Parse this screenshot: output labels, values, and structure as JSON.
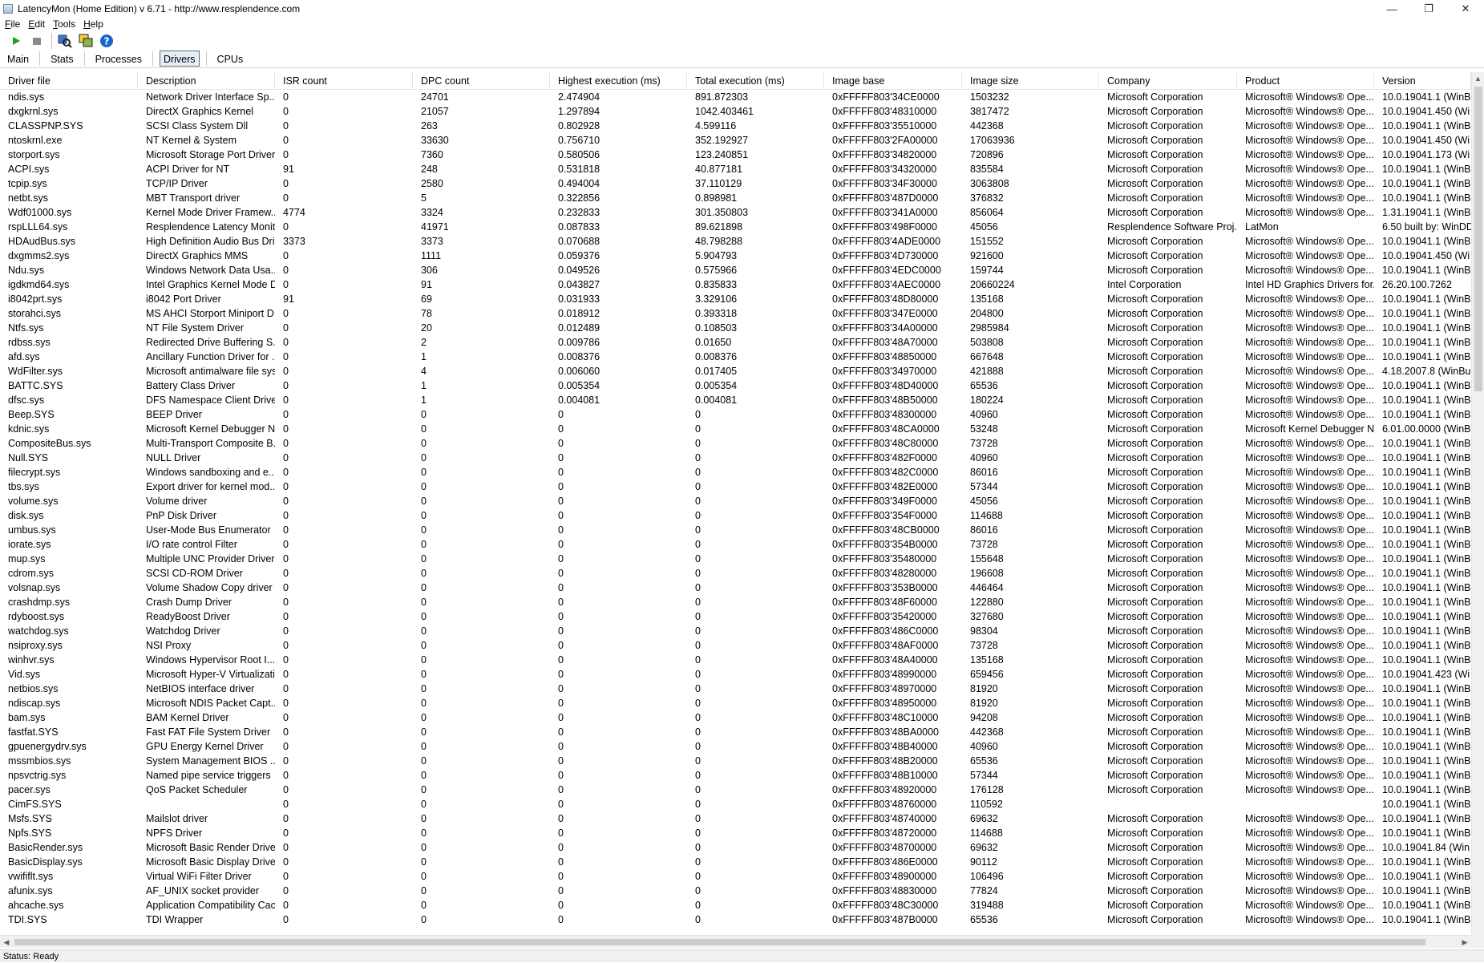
{
  "window": {
    "title": "LatencyMon  (Home Edition)  v 6.71 - http://www.resplendence.com",
    "controls": [
      "—",
      "❐",
      "✕"
    ]
  },
  "menu": [
    {
      "label": "File",
      "u": "F",
      "rest": "ile"
    },
    {
      "label": "Edit",
      "u": "E",
      "rest": "dit"
    },
    {
      "label": "Tools",
      "u": "T",
      "rest": "ools"
    },
    {
      "label": "Help",
      "u": "H",
      "rest": "elp"
    }
  ],
  "toolbar": {
    "icons": [
      "play-icon",
      "stop-icon",
      "driver-search-icon",
      "windows-icon",
      "help-icon"
    ],
    "colors": {
      "play": "#19a319",
      "stop": "#8a8a8a",
      "help": "#1b64c9"
    }
  },
  "tabs": [
    "Main",
    "Stats",
    "Processes",
    "Drivers",
    "CPUs"
  ],
  "active_tab": "Drivers",
  "columns": [
    "Driver file",
    "Description",
    "ISR count",
    "DPC count",
    "Highest execution (ms)",
    "Total execution (ms)",
    "Image base",
    "Image size",
    "Company",
    "Product",
    "Version"
  ],
  "rows": [
    [
      "ndis.sys",
      "Network Driver Interface Sp...",
      "0",
      "24701",
      "2.474904",
      "891.872303",
      "0xFFFFF803'34CE0000",
      "1503232",
      "Microsoft Corporation",
      "Microsoft® Windows® Ope...",
      "10.0.19041.1 (WinB"
    ],
    [
      "dxgkrnl.sys",
      "DirectX Graphics Kernel",
      "0",
      "21057",
      "1.297894",
      "1042.403461",
      "0xFFFFF803'48310000",
      "3817472",
      "Microsoft Corporation",
      "Microsoft® Windows® Ope...",
      "10.0.19041.450 (Wi"
    ],
    [
      "CLASSPNP.SYS",
      "SCSI Class System Dll",
      "0",
      "263",
      "0.802928",
      "4.599116",
      "0xFFFFF803'35510000",
      "442368",
      "Microsoft Corporation",
      "Microsoft® Windows® Ope...",
      "10.0.19041.1 (WinB"
    ],
    [
      "ntoskrnl.exe",
      "NT Kernel & System",
      "0",
      "33630",
      "0.756710",
      "352.192927",
      "0xFFFFF803'2FA00000",
      "17063936",
      "Microsoft Corporation",
      "Microsoft® Windows® Ope...",
      "10.0.19041.450 (Wi"
    ],
    [
      "storport.sys",
      "Microsoft Storage Port Driver",
      "0",
      "7360",
      "0.580506",
      "123.240851",
      "0xFFFFF803'34820000",
      "720896",
      "Microsoft Corporation",
      "Microsoft® Windows® Ope...",
      "10.0.19041.173 (Wi"
    ],
    [
      "ACPI.sys",
      "ACPI Driver for NT",
      "91",
      "248",
      "0.531818",
      "40.877181",
      "0xFFFFF803'34320000",
      "835584",
      "Microsoft Corporation",
      "Microsoft® Windows® Ope...",
      "10.0.19041.1 (WinB"
    ],
    [
      "tcpip.sys",
      "TCP/IP Driver",
      "0",
      "2580",
      "0.494004",
      "37.110129",
      "0xFFFFF803'34F30000",
      "3063808",
      "Microsoft Corporation",
      "Microsoft® Windows® Ope...",
      "10.0.19041.1 (WinB"
    ],
    [
      "netbt.sys",
      "MBT Transport driver",
      "0",
      "5",
      "0.322856",
      "0.898981",
      "0xFFFFF803'487D0000",
      "376832",
      "Microsoft Corporation",
      "Microsoft® Windows® Ope...",
      "10.0.19041.1 (WinB"
    ],
    [
      "Wdf01000.sys",
      "Kernel Mode Driver Framew...",
      "4774",
      "3324",
      "0.232833",
      "301.350803",
      "0xFFFFF803'341A0000",
      "856064",
      "Microsoft Corporation",
      "Microsoft® Windows® Ope...",
      "1.31.19041.1 (WinB"
    ],
    [
      "rspLLL64.sys",
      "Resplendence Latency Monit...",
      "0",
      "41971",
      "0.087833",
      "89.621898",
      "0xFFFFF803'498F0000",
      "45056",
      "Resplendence Software Proj...",
      "LatMon",
      "6.50 built by: WinDD"
    ],
    [
      "HDAudBus.sys",
      "High Definition Audio Bus Dri...",
      "3373",
      "3373",
      "0.070688",
      "48.798288",
      "0xFFFFF803'4ADE0000",
      "151552",
      "Microsoft Corporation",
      "Microsoft® Windows® Ope...",
      "10.0.19041.1 (WinB"
    ],
    [
      "dxgmms2.sys",
      "DirectX Graphics MMS",
      "0",
      "1111",
      "0.059376",
      "5.904793",
      "0xFFFFF803'4D730000",
      "921600",
      "Microsoft Corporation",
      "Microsoft® Windows® Ope...",
      "10.0.19041.450 (Wi"
    ],
    [
      "Ndu.sys",
      "Windows Network Data Usa...",
      "0",
      "306",
      "0.049526",
      "0.575966",
      "0xFFFFF803'4EDC0000",
      "159744",
      "Microsoft Corporation",
      "Microsoft® Windows® Ope...",
      "10.0.19041.1 (WinB"
    ],
    [
      "igdkmd64.sys",
      "Intel Graphics Kernel Mode D...",
      "0",
      "91",
      "0.043827",
      "0.835833",
      "0xFFFFF803'4AEC0000",
      "20660224",
      "Intel Corporation",
      "Intel HD Graphics Drivers for...",
      "26.20.100.7262"
    ],
    [
      "i8042prt.sys",
      "i8042 Port Driver",
      "91",
      "69",
      "0.031933",
      "3.329106",
      "0xFFFFF803'48D80000",
      "135168",
      "Microsoft Corporation",
      "Microsoft® Windows® Ope...",
      "10.0.19041.1 (WinB"
    ],
    [
      "storahci.sys",
      "MS AHCI Storport Miniport D...",
      "0",
      "78",
      "0.018912",
      "0.393318",
      "0xFFFFF803'347E0000",
      "204800",
      "Microsoft Corporation",
      "Microsoft® Windows® Ope...",
      "10.0.19041.1 (WinB"
    ],
    [
      "Ntfs.sys",
      "NT File System Driver",
      "0",
      "20",
      "0.012489",
      "0.108503",
      "0xFFFFF803'34A00000",
      "2985984",
      "Microsoft Corporation",
      "Microsoft® Windows® Ope...",
      "10.0.19041.1 (WinB"
    ],
    [
      "rdbss.sys",
      "Redirected Drive Buffering S...",
      "0",
      "2",
      "0.009786",
      "0.01650",
      "0xFFFFF803'48A70000",
      "503808",
      "Microsoft Corporation",
      "Microsoft® Windows® Ope...",
      "10.0.19041.1 (WinB"
    ],
    [
      "afd.sys",
      "Ancillary Function Driver for ...",
      "0",
      "1",
      "0.008376",
      "0.008376",
      "0xFFFFF803'48850000",
      "667648",
      "Microsoft Corporation",
      "Microsoft® Windows® Ope...",
      "10.0.19041.1 (WinB"
    ],
    [
      "WdFilter.sys",
      "Microsoft antimalware file sys...",
      "0",
      "4",
      "0.006060",
      "0.017405",
      "0xFFFFF803'34970000",
      "421888",
      "Microsoft Corporation",
      "Microsoft® Windows® Ope...",
      "4.18.2007.8 (WinBu"
    ],
    [
      "BATTC.SYS",
      "Battery Class Driver",
      "0",
      "1",
      "0.005354",
      "0.005354",
      "0xFFFFF803'48D40000",
      "65536",
      "Microsoft Corporation",
      "Microsoft® Windows® Ope...",
      "10.0.19041.1 (WinB"
    ],
    [
      "dfsc.sys",
      "DFS Namespace Client Driver",
      "0",
      "1",
      "0.004081",
      "0.004081",
      "0xFFFFF803'48B50000",
      "180224",
      "Microsoft Corporation",
      "Microsoft® Windows® Ope...",
      "10.0.19041.1 (WinB"
    ],
    [
      "Beep.SYS",
      "BEEP Driver",
      "0",
      "0",
      "0",
      "0",
      "0xFFFFF803'48300000",
      "40960",
      "Microsoft Corporation",
      "Microsoft® Windows® Ope...",
      "10.0.19041.1 (WinB"
    ],
    [
      "kdnic.sys",
      "Microsoft Kernel Debugger N...",
      "0",
      "0",
      "0",
      "0",
      "0xFFFFF803'48CA0000",
      "53248",
      "Microsoft Corporation",
      "Microsoft Kernel Debugger N...",
      "6.01.00.0000 (WinB"
    ],
    [
      "CompositeBus.sys",
      "Multi-Transport Composite B...",
      "0",
      "0",
      "0",
      "0",
      "0xFFFFF803'48C80000",
      "73728",
      "Microsoft Corporation",
      "Microsoft® Windows® Ope...",
      "10.0.19041.1 (WinB"
    ],
    [
      "Null.SYS",
      "NULL Driver",
      "0",
      "0",
      "0",
      "0",
      "0xFFFFF803'482F0000",
      "40960",
      "Microsoft Corporation",
      "Microsoft® Windows® Ope...",
      "10.0.19041.1 (WinB"
    ],
    [
      "filecrypt.sys",
      "Windows sandboxing and e...",
      "0",
      "0",
      "0",
      "0",
      "0xFFFFF803'482C0000",
      "86016",
      "Microsoft Corporation",
      "Microsoft® Windows® Ope...",
      "10.0.19041.1 (WinB"
    ],
    [
      "tbs.sys",
      "Export driver for kernel mod...",
      "0",
      "0",
      "0",
      "0",
      "0xFFFFF803'482E0000",
      "57344",
      "Microsoft Corporation",
      "Microsoft® Windows® Ope...",
      "10.0.19041.1 (WinB"
    ],
    [
      "volume.sys",
      "Volume driver",
      "0",
      "0",
      "0",
      "0",
      "0xFFFFF803'349F0000",
      "45056",
      "Microsoft Corporation",
      "Microsoft® Windows® Ope...",
      "10.0.19041.1 (WinB"
    ],
    [
      "disk.sys",
      "PnP Disk Driver",
      "0",
      "0",
      "0",
      "0",
      "0xFFFFF803'354F0000",
      "114688",
      "Microsoft Corporation",
      "Microsoft® Windows® Ope...",
      "10.0.19041.1 (WinB"
    ],
    [
      "umbus.sys",
      "User-Mode Bus Enumerator",
      "0",
      "0",
      "0",
      "0",
      "0xFFFFF803'48CB0000",
      "86016",
      "Microsoft Corporation",
      "Microsoft® Windows® Ope...",
      "10.0.19041.1 (WinB"
    ],
    [
      "iorate.sys",
      "I/O rate control Filter",
      "0",
      "0",
      "0",
      "0",
      "0xFFFFF803'354B0000",
      "73728",
      "Microsoft Corporation",
      "Microsoft® Windows® Ope...",
      "10.0.19041.1 (WinB"
    ],
    [
      "mup.sys",
      "Multiple UNC Provider Driver",
      "0",
      "0",
      "0",
      "0",
      "0xFFFFF803'35480000",
      "155648",
      "Microsoft Corporation",
      "Microsoft® Windows® Ope...",
      "10.0.19041.1 (WinB"
    ],
    [
      "cdrom.sys",
      "SCSI CD-ROM Driver",
      "0",
      "0",
      "0",
      "0",
      "0xFFFFF803'48280000",
      "196608",
      "Microsoft Corporation",
      "Microsoft® Windows® Ope...",
      "10.0.19041.1 (WinB"
    ],
    [
      "volsnap.sys",
      "Volume Shadow Copy driver",
      "0",
      "0",
      "0",
      "0",
      "0xFFFFF803'353B0000",
      "446464",
      "Microsoft Corporation",
      "Microsoft® Windows® Ope...",
      "10.0.19041.1 (WinB"
    ],
    [
      "crashdmp.sys",
      "Crash Dump Driver",
      "0",
      "0",
      "0",
      "0",
      "0xFFFFF803'48F60000",
      "122880",
      "Microsoft Corporation",
      "Microsoft® Windows® Ope...",
      "10.0.19041.1 (WinB"
    ],
    [
      "rdyboost.sys",
      "ReadyBoost Driver",
      "0",
      "0",
      "0",
      "0",
      "0xFFFFF803'35420000",
      "327680",
      "Microsoft Corporation",
      "Microsoft® Windows® Ope...",
      "10.0.19041.1 (WinB"
    ],
    [
      "watchdog.sys",
      "Watchdog Driver",
      "0",
      "0",
      "0",
      "0",
      "0xFFFFF803'486C0000",
      "98304",
      "Microsoft Corporation",
      "Microsoft® Windows® Ope...",
      "10.0.19041.1 (WinB"
    ],
    [
      "nsiproxy.sys",
      "NSI Proxy",
      "0",
      "0",
      "0",
      "0",
      "0xFFFFF803'48AF0000",
      "73728",
      "Microsoft Corporation",
      "Microsoft® Windows® Ope...",
      "10.0.19041.1 (WinB"
    ],
    [
      "winhvr.sys",
      "Windows Hypervisor Root I...",
      "0",
      "0",
      "0",
      "0",
      "0xFFFFF803'48A40000",
      "135168",
      "Microsoft Corporation",
      "Microsoft® Windows® Ope...",
      "10.0.19041.1 (WinB"
    ],
    [
      "Vid.sys",
      "Microsoft Hyper-V Virtualizati...",
      "0",
      "0",
      "0",
      "0",
      "0xFFFFF803'48990000",
      "659456",
      "Microsoft Corporation",
      "Microsoft® Windows® Ope...",
      "10.0.19041.423 (Wi"
    ],
    [
      "netbios.sys",
      "NetBIOS interface driver",
      "0",
      "0",
      "0",
      "0",
      "0xFFFFF803'48970000",
      "81920",
      "Microsoft Corporation",
      "Microsoft® Windows® Ope...",
      "10.0.19041.1 (WinB"
    ],
    [
      "ndiscap.sys",
      "Microsoft NDIS Packet Capt...",
      "0",
      "0",
      "0",
      "0",
      "0xFFFFF803'48950000",
      "81920",
      "Microsoft Corporation",
      "Microsoft® Windows® Ope...",
      "10.0.19041.1 (WinB"
    ],
    [
      "bam.sys",
      "BAM Kernel Driver",
      "0",
      "0",
      "0",
      "0",
      "0xFFFFF803'48C10000",
      "94208",
      "Microsoft Corporation",
      "Microsoft® Windows® Ope...",
      "10.0.19041.1 (WinB"
    ],
    [
      "fastfat.SYS",
      "Fast FAT File System Driver",
      "0",
      "0",
      "0",
      "0",
      "0xFFFFF803'48BA0000",
      "442368",
      "Microsoft Corporation",
      "Microsoft® Windows® Ope...",
      "10.0.19041.1 (WinB"
    ],
    [
      "gpuenergydrv.sys",
      "GPU Energy Kernel Driver",
      "0",
      "0",
      "0",
      "0",
      "0xFFFFF803'48B40000",
      "40960",
      "Microsoft Corporation",
      "Microsoft® Windows® Ope...",
      "10.0.19041.1 (WinB"
    ],
    [
      "mssmbios.sys",
      "System Management BIOS ...",
      "0",
      "0",
      "0",
      "0",
      "0xFFFFF803'48B20000",
      "65536",
      "Microsoft Corporation",
      "Microsoft® Windows® Ope...",
      "10.0.19041.1 (WinB"
    ],
    [
      "npsvctrig.sys",
      "Named pipe service triggers",
      "0",
      "0",
      "0",
      "0",
      "0xFFFFF803'48B10000",
      "57344",
      "Microsoft Corporation",
      "Microsoft® Windows® Ope...",
      "10.0.19041.1 (WinB"
    ],
    [
      "pacer.sys",
      "QoS Packet Scheduler",
      "0",
      "0",
      "0",
      "0",
      "0xFFFFF803'48920000",
      "176128",
      "Microsoft Corporation",
      "Microsoft® Windows® Ope...",
      "10.0.19041.1 (WinB"
    ],
    [
      "CimFS.SYS",
      "",
      "0",
      "0",
      "0",
      "0",
      "0xFFFFF803'48760000",
      "110592",
      "",
      "",
      "10.0.19041.1 (WinB"
    ],
    [
      "Msfs.SYS",
      "Mailslot driver",
      "0",
      "0",
      "0",
      "0",
      "0xFFFFF803'48740000",
      "69632",
      "Microsoft Corporation",
      "Microsoft® Windows® Ope...",
      "10.0.19041.1 (WinB"
    ],
    [
      "Npfs.SYS",
      "NPFS Driver",
      "0",
      "0",
      "0",
      "0",
      "0xFFFFF803'48720000",
      "114688",
      "Microsoft Corporation",
      "Microsoft® Windows® Ope...",
      "10.0.19041.1 (WinB"
    ],
    [
      "BasicRender.sys",
      "Microsoft Basic Render Driver",
      "0",
      "0",
      "0",
      "0",
      "0xFFFFF803'48700000",
      "69632",
      "Microsoft Corporation",
      "Microsoft® Windows® Ope...",
      "10.0.19041.84 (Win"
    ],
    [
      "BasicDisplay.sys",
      "Microsoft Basic Display Driver",
      "0",
      "0",
      "0",
      "0",
      "0xFFFFF803'486E0000",
      "90112",
      "Microsoft Corporation",
      "Microsoft® Windows® Ope...",
      "10.0.19041.1 (WinB"
    ],
    [
      "vwififlt.sys",
      "Virtual WiFi Filter Driver",
      "0",
      "0",
      "0",
      "0",
      "0xFFFFF803'48900000",
      "106496",
      "Microsoft Corporation",
      "Microsoft® Windows® Ope...",
      "10.0.19041.1 (WinB"
    ],
    [
      "afunix.sys",
      "AF_UNIX socket provider",
      "0",
      "0",
      "0",
      "0",
      "0xFFFFF803'48830000",
      "77824",
      "Microsoft Corporation",
      "Microsoft® Windows® Ope...",
      "10.0.19041.1 (WinB"
    ],
    [
      "ahcache.sys",
      "Application Compatibility Cac...",
      "0",
      "0",
      "0",
      "0",
      "0xFFFFF803'48C30000",
      "319488",
      "Microsoft Corporation",
      "Microsoft® Windows® Ope...",
      "10.0.19041.1 (WinB"
    ],
    [
      "TDI.SYS",
      "TDI Wrapper",
      "0",
      "0",
      "0",
      "0",
      "0xFFFFF803'487B0000",
      "65536",
      "Microsoft Corporation",
      "Microsoft® Windows® Ope...",
      "10.0.19041.1 (WinB"
    ]
  ],
  "status": "Status: Ready"
}
